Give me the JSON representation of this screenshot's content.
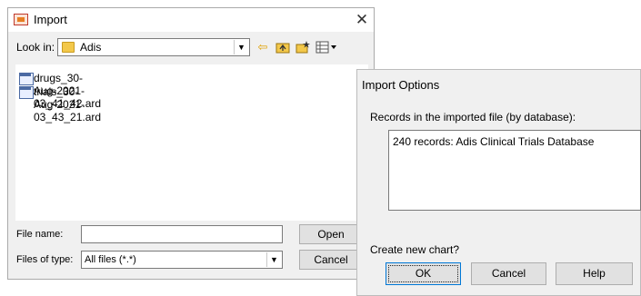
{
  "import_dialog": {
    "title": "Import",
    "close_glyph": "✕",
    "look_in_label": "Look in:",
    "look_in_value": "Adis",
    "files": [
      {
        "name": "drugs_30-Aug-2021-03_41_42.ard"
      },
      {
        "name": "trials_30-Aug-2021-03_43_21.ard"
      }
    ],
    "file_name_label": "File name:",
    "file_name_value": "",
    "files_of_type_label": "Files of type:",
    "files_of_type_value": "All files (*.*)",
    "open_label": "Open",
    "cancel_label": "Cancel",
    "toolbar_icons": [
      "back-arrow-icon",
      "up-folder-icon",
      "new-folder-icon",
      "view-menu-icon"
    ]
  },
  "options_dialog": {
    "title": "Import Options",
    "records_label": "Records in the imported file (by database):",
    "records_items": [
      "240 records: Adis Clinical Trials Database"
    ],
    "create_chart_label": "Create new chart?",
    "ok_label": "OK",
    "cancel_label": "Cancel",
    "help_label": "Help"
  },
  "colors": {
    "dialog_bg": "#f0f0f0",
    "button_bg": "#e1e1e1",
    "focus_border": "#0078d7"
  }
}
